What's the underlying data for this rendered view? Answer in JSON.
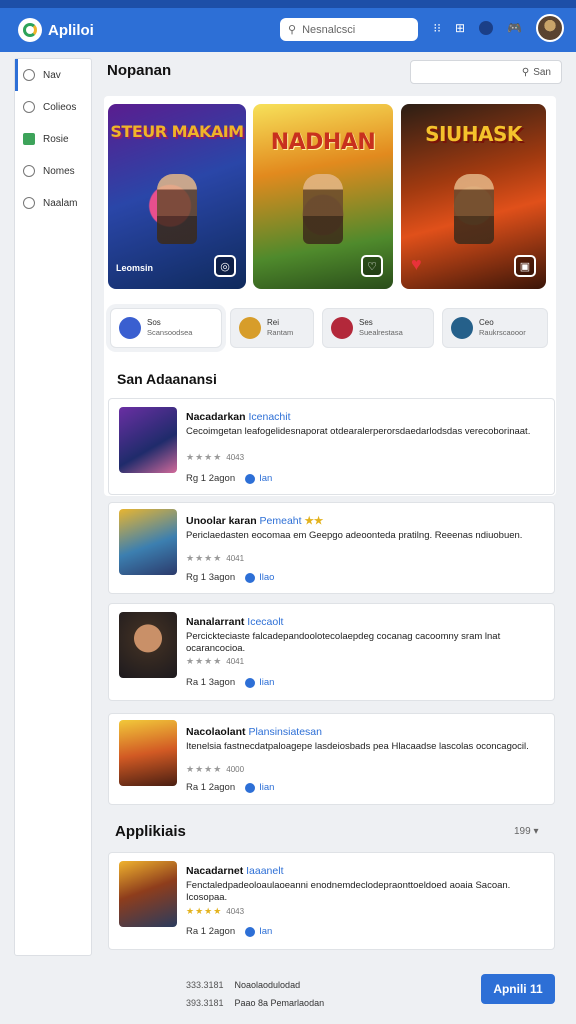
{
  "app": {
    "name": "Apliloi"
  },
  "header": {
    "search_placeholder": "Nesnalcsci"
  },
  "sidebar": {
    "items": [
      {
        "label": "Nav",
        "icon": "home-icon"
      },
      {
        "label": "Colieos",
        "icon": "collections-icon"
      },
      {
        "label": "Rosie",
        "icon": "square-icon"
      },
      {
        "label": "Nomes",
        "icon": "user-icon"
      },
      {
        "label": "Naalam",
        "icon": "settings-icon"
      }
    ]
  },
  "main": {
    "title": "Nopanan",
    "search_placeholder": "San",
    "banners": [
      {
        "title": "STEUR MAKAIM",
        "caption": "Leomsin"
      },
      {
        "title": "NADHAN",
        "caption": ""
      },
      {
        "title": "SIUHASK",
        "caption": ""
      }
    ],
    "chips": [
      {
        "title": "Sos",
        "sub": "Scansoodsea"
      },
      {
        "title": "Rei",
        "sub": "Rantam"
      },
      {
        "title": "Ses",
        "sub": "Suealrestasa"
      },
      {
        "title": "Ceo",
        "sub": "Raukrscaooor"
      }
    ],
    "section_title": "San Adaanansi",
    "items": [
      {
        "name": "Nacadarkan",
        "tag": "Icenachit",
        "desc": "Cecoimgetan leafogelidesnaporat otdearalerperorsdaedarlodsdas verecoborinaat.",
        "rating_text": "★★★★",
        "rating_count": "4043",
        "meta": "Rg 1 2agon",
        "action": "Ian"
      },
      {
        "name": "Unoolar karan",
        "tag": "Pemeaht",
        "desc": "Periclaedasten eocomaa em Geepgo adeoonteda pratilng. Reeenas ndiuobuen.",
        "rating_text": "★★★★",
        "rating_count": "4041",
        "meta": "Rg 1 3agon",
        "action": "Ilao"
      },
      {
        "name": "Nanalarrant",
        "tag": "Icecaolt",
        "desc": "Percickteciaste falcadepandoolotecolaepdeg cocanag cacoomny sram lnat ocarancocioa.",
        "rating_text": "★★★★",
        "rating_count": "4041",
        "meta": "Ra 1 3agon",
        "action": "Iian"
      },
      {
        "name": "Nacolaolant",
        "tag": "Plansinsiatesan",
        "desc": "Itenelsia fastnecdatpaloagepe lasdeiosbads pea Hlacaadse lascolas oconcagocil.",
        "rating_text": "★★★★",
        "rating_count": "4000",
        "meta": "Ra 1 2agon",
        "action": "Iian"
      }
    ]
  },
  "applications": {
    "title": "Applikiais",
    "count": "199",
    "items": [
      {
        "name": "Nacadarnet",
        "tag": "Iaaanelt",
        "desc": "Fenctaledpadeoloaulaoeanni enodnemdeclodepraonttoeldoed aoaia Sacoan. Icosopaa.",
        "rating_text": "★★★★",
        "rating_count": "4043",
        "meta": "Ra 1 2agon",
        "action": "Ian"
      }
    ]
  },
  "footer": {
    "rows": [
      {
        "code": "333.3181",
        "text": "Noaolaodulodad"
      },
      {
        "code": "393.3181",
        "text": "Paao 8a Pemarlaodan"
      }
    ],
    "cta": "Apnili 11"
  }
}
